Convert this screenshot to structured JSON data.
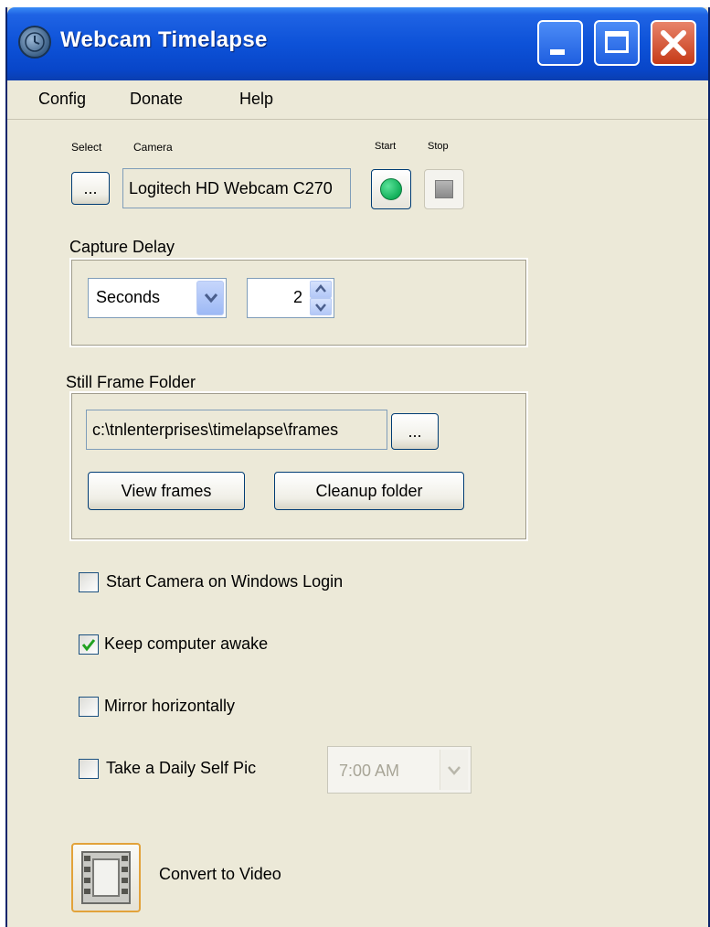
{
  "window": {
    "title": "Webcam Timelapse"
  },
  "menu": {
    "items": [
      "Config",
      "Donate",
      "Help"
    ]
  },
  "camera": {
    "select_label": "Select",
    "camera_label": "Camera",
    "start_label": "Start",
    "stop_label": "Stop",
    "browse_label": "...",
    "camera_value": "Logitech HD Webcam C270"
  },
  "capture_delay": {
    "label": "Capture Delay",
    "unit_value": "Seconds",
    "amount_value": "2"
  },
  "still_folder": {
    "label": "Still Frame Folder",
    "path_value": "c:\\tnlenterprises\\timelapse\\frames",
    "browse_label": "...",
    "view_label": "View frames",
    "cleanup_label": "Cleanup folder"
  },
  "options": {
    "start_on_login": {
      "label": "Start Camera on Windows Login",
      "checked": false
    },
    "keep_awake": {
      "label": "Keep computer awake",
      "checked": true
    },
    "mirror": {
      "label": "Mirror horizontally",
      "checked": false
    },
    "daily_pic": {
      "label": "Take a Daily Self Pic",
      "checked": false,
      "time_value": "7:00 AM"
    }
  },
  "convert": {
    "label": "Convert to Video"
  },
  "colors": {
    "titlebar": "#0d52d8",
    "face": "#ece9d8",
    "start_green": "#12b05a",
    "check_green": "#21a121"
  }
}
